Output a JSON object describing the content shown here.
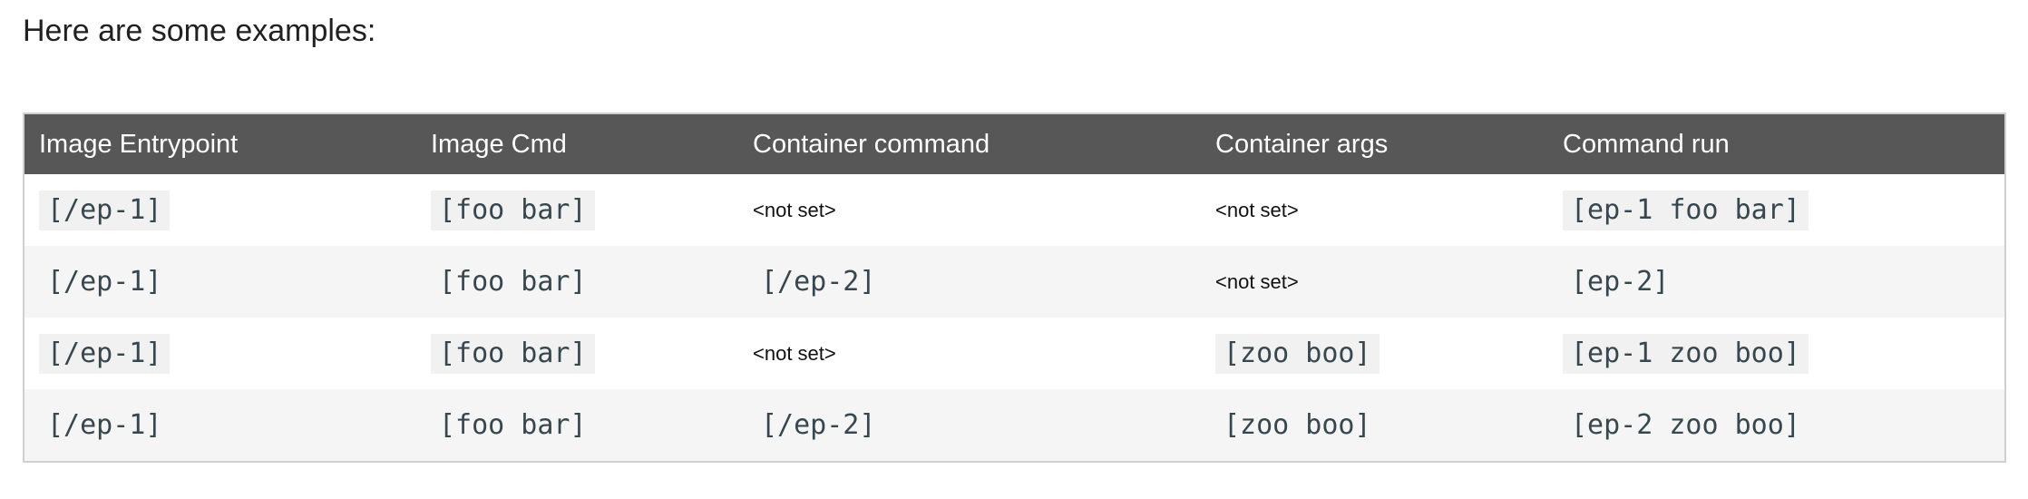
{
  "intro_text": "Here are some examples:",
  "table": {
    "headers": [
      "Image Entrypoint",
      "Image Cmd",
      "Container command",
      "Container args",
      "Command run"
    ],
    "rows": [
      [
        "[/ep-1]",
        "[foo bar]",
        "<not set>",
        "<not set>",
        "[ep-1 foo bar]"
      ],
      [
        "[/ep-1]",
        "[foo bar]",
        "[/ep-2]",
        "<not set>",
        "[ep-2]"
      ],
      [
        "[/ep-1]",
        "[foo bar]",
        "<not set>",
        "[zoo boo]",
        "[ep-1 zoo boo]"
      ],
      [
        "[/ep-1]",
        "[foo bar]",
        "[/ep-2]",
        "[zoo boo]",
        "[ep-2 zoo boo]"
      ]
    ]
  }
}
